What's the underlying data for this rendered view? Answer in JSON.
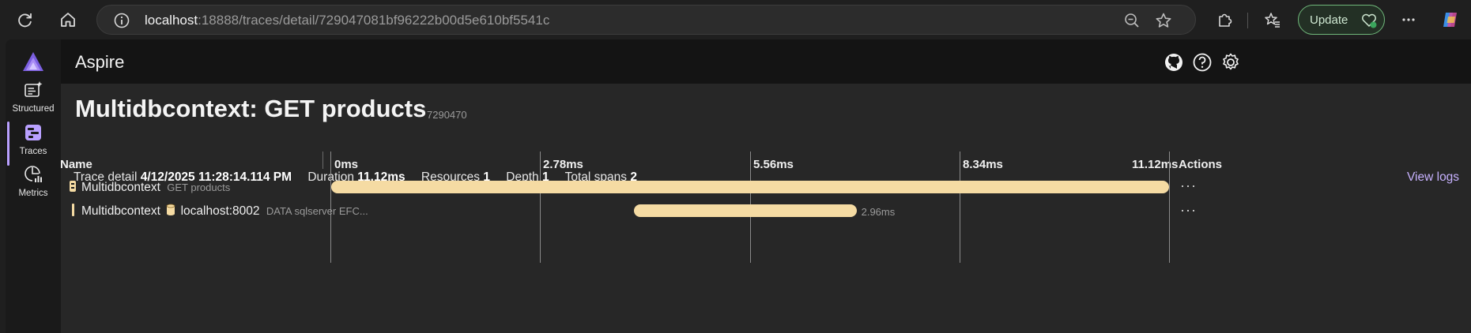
{
  "browser": {
    "url_host": "localhost",
    "url_rest": ":18888/traces/detail/729047081bf96222b00d5e610bf5541c",
    "update_label": "Update"
  },
  "app": {
    "title": "Aspire",
    "accent": "#b9a0ff",
    "sidebar": [
      {
        "label": "Structured",
        "icon": "structured-logs-icon"
      },
      {
        "label": "Traces",
        "icon": "traces-icon"
      },
      {
        "label": "Metrics",
        "icon": "metrics-icon"
      }
    ]
  },
  "page": {
    "title": "Multidbcontext: GET products",
    "trace_id": "7290470",
    "meta": {
      "trace_detail_label": "Trace detail",
      "trace_detail_value": "4/12/2025 11:28:14.114 PM",
      "duration_label": "Duration",
      "duration_value": "11.12ms",
      "resources_label": "Resources",
      "resources_value": "1",
      "depth_label": "Depth",
      "depth_value": "1",
      "total_spans_label": "Total spans",
      "total_spans_value": "2"
    },
    "view_logs": "View logs",
    "columns": {
      "name": "Name",
      "ticks": [
        "0ms",
        "2.78ms",
        "5.56ms",
        "8.34ms",
        "11.12ms"
      ],
      "actions": "Actions"
    },
    "spans": [
      {
        "resource": "Multidbcontext",
        "operation": "GET products",
        "start_fraction": 0.0,
        "end_fraction": 1.0,
        "duration_label": "",
        "bar_color": "#f5dba3"
      },
      {
        "resource": "Multidbcontext",
        "target": "localhost:8002",
        "operation": "DATA sqlserver EFC...",
        "start_fraction": 0.361,
        "end_fraction": 0.627,
        "duration_label": "2.96ms",
        "bar_color": "#f5dba3"
      }
    ]
  }
}
